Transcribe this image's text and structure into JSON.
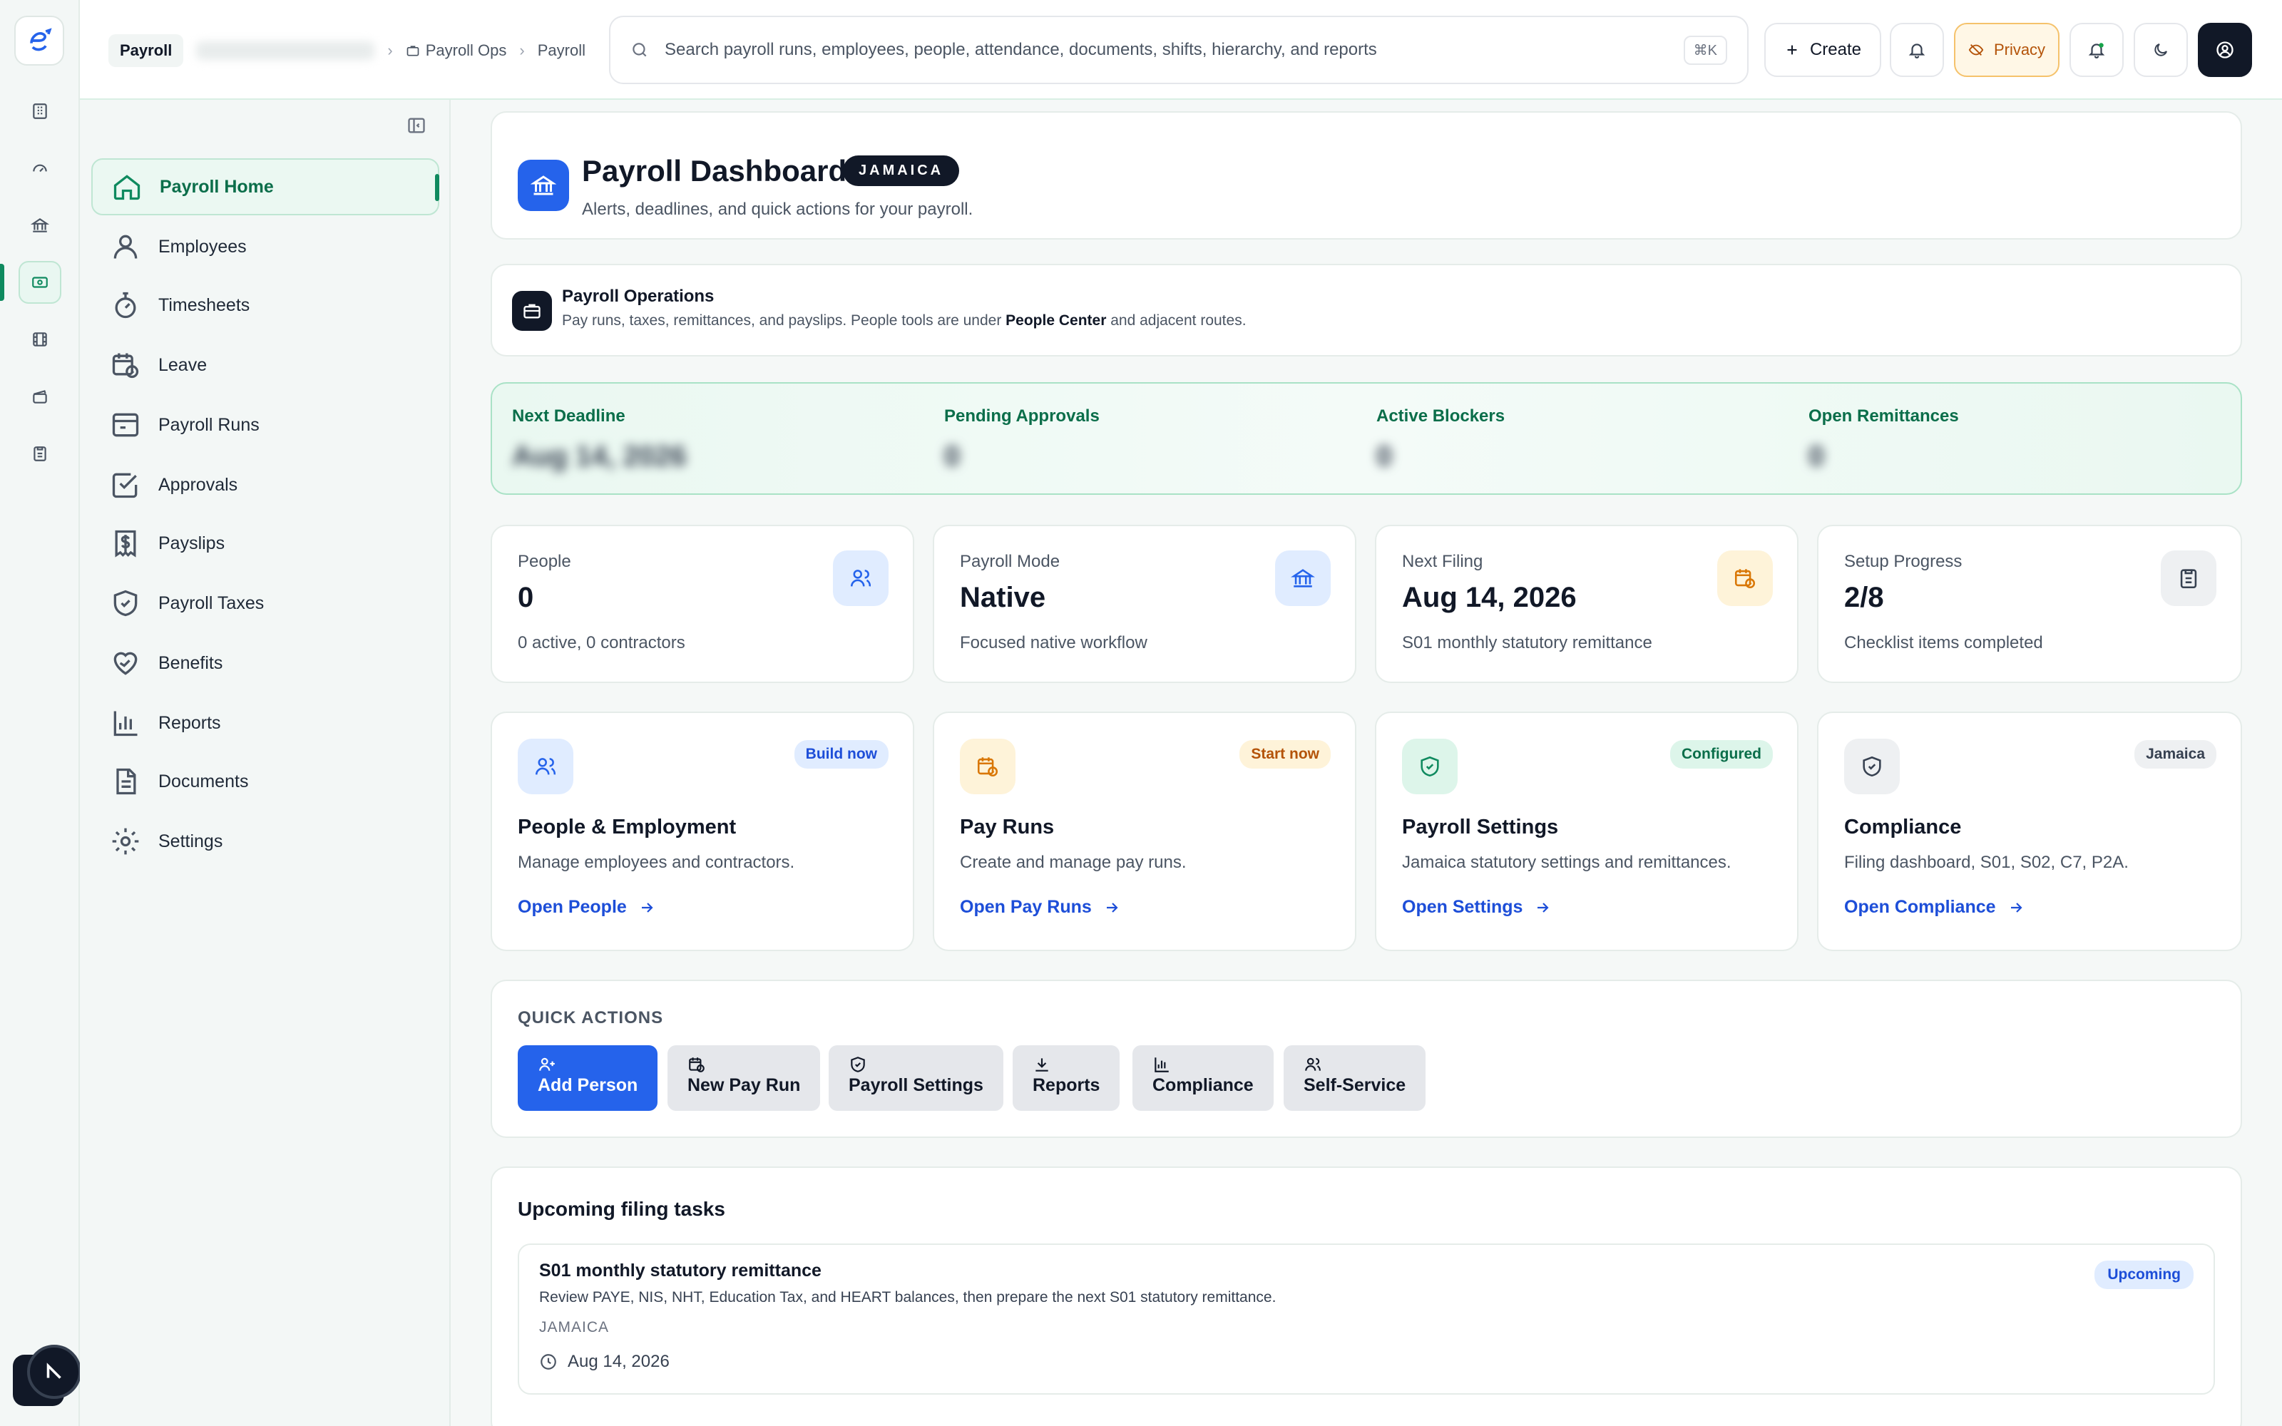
{
  "topbar": {
    "crumbs": {
      "root": "Payroll",
      "ops": "Payroll Ops",
      "current": "Payroll"
    },
    "search": {
      "placeholder": "Search payroll runs, employees, people, attendance, documents, shifts, hierarchy, and reports",
      "shortcut": "⌘K"
    },
    "create_label": "Create",
    "privacy_label": "Privacy"
  },
  "sidebar": {
    "items": [
      {
        "label": "Payroll Home"
      },
      {
        "label": "Employees"
      },
      {
        "label": "Timesheets"
      },
      {
        "label": "Leave"
      },
      {
        "label": "Payroll Runs"
      },
      {
        "label": "Approvals"
      },
      {
        "label": "Payslips"
      },
      {
        "label": "Payroll Taxes"
      },
      {
        "label": "Benefits"
      },
      {
        "label": "Reports"
      },
      {
        "label": "Documents"
      },
      {
        "label": "Settings"
      }
    ]
  },
  "header": {
    "title": "Payroll Dashboard",
    "country": "JAMAICA",
    "subtitle": "Alerts, deadlines, and quick actions for your payroll."
  },
  "ops": {
    "title": "Payroll Operations",
    "desc_before": "Pay runs, taxes, remittances, and payslips. People tools are under ",
    "desc_bold": "People Center",
    "desc_after": " and adjacent routes."
  },
  "kpis": [
    {
      "label": "Next Deadline",
      "value": "Aug 14, 2026"
    },
    {
      "label": "Pending Approvals",
      "value": "0"
    },
    {
      "label": "Active Blockers",
      "value": "0"
    },
    {
      "label": "Open Remittances",
      "value": "0"
    }
  ],
  "stats": [
    {
      "label": "People",
      "value": "0",
      "sub": "0 active, 0 contractors",
      "icon": "users-icon"
    },
    {
      "label": "Payroll Mode",
      "value": "Native",
      "sub": "Focused native workflow",
      "icon": "bank-icon"
    },
    {
      "label": "Next Filing",
      "value": "Aug 14, 2026",
      "sub": "S01 monthly statutory remittance",
      "icon": "calendar-clock-icon"
    },
    {
      "label": "Setup Progress",
      "value": "2/8",
      "sub": "Checklist items completed",
      "icon": "clipboard-icon"
    }
  ],
  "features": [
    {
      "badge": "Build now",
      "title": "People & Employment",
      "desc": "Manage employees and contractors.",
      "link": "Open People"
    },
    {
      "badge": "Start now",
      "title": "Pay Runs",
      "desc": "Create and manage pay runs.",
      "link": "Open Pay Runs"
    },
    {
      "badge": "Configured",
      "title": "Payroll Settings",
      "desc": "Jamaica statutory settings and remittances.",
      "link": "Open Settings"
    },
    {
      "badge": "Jamaica",
      "title": "Compliance",
      "desc": "Filing dashboard, S01, S02, C7, P2A.",
      "link": "Open Compliance"
    }
  ],
  "quick_actions": {
    "title": "QUICK ACTIONS",
    "buttons": [
      {
        "label": "Add Person"
      },
      {
        "label": "New Pay Run"
      },
      {
        "label": "Payroll Settings"
      },
      {
        "label": "Reports"
      },
      {
        "label": "Compliance"
      },
      {
        "label": "Self-Service"
      }
    ]
  },
  "tasks": {
    "title": "Upcoming filing tasks",
    "items": [
      {
        "title": "S01 monthly statutory remittance",
        "desc": "Review PAYE, NIS, NHT, Education Tax, and HEART balances, then prepare the next S01 statutory remittance.",
        "country": "JAMAICA",
        "date": "Aug 14, 2026",
        "status": "Upcoming"
      }
    ]
  },
  "colors": {
    "accent_green": "#0f8a5f",
    "primary_blue": "#2563eb",
    "privacy_orange": "#b45309"
  }
}
